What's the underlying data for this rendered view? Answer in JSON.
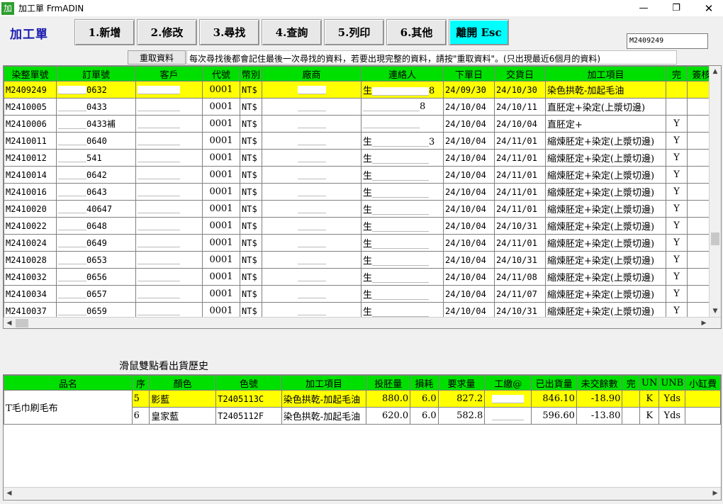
{
  "window": {
    "icon_text": "加",
    "title": "加工單 FrmADIN",
    "min": "—",
    "max": "❐",
    "close": "✕"
  },
  "form_title": "加工單",
  "toolbar": [
    {
      "label": "1.新增"
    },
    {
      "label": "2.修改"
    },
    {
      "label": "3.尋找"
    },
    {
      "label": "4.查詢"
    },
    {
      "label": "5.列印"
    },
    {
      "label": "6.其他"
    },
    {
      "label": "離開 Esc"
    }
  ],
  "current_code": "M2409249",
  "reload_label": "重取資料",
  "hint_text": "每次尋找後都會記住最後一次尋找的資料，若要出現完整的資料，請按\"重取資料\"。(只出現最近6個月的資料)",
  "orders": {
    "columns": [
      "染整單號",
      "訂單號",
      "客戶",
      "代號",
      "幣別",
      "廠商",
      "連絡人",
      "下單日",
      "交貨日",
      "加工項目",
      "完",
      "簽核"
    ],
    "rows": [
      {
        "no": "M2409249",
        "order": "0632",
        "code": "0001",
        "cur": "NT$",
        "contact_prefix": "生",
        "contact_suffix": "8",
        "order_date": "24/09/30",
        "due": "24/10/30",
        "item": "染色拱乾-加起毛油",
        "done": ""
      },
      {
        "no": "M2410005",
        "order": "0433",
        "code": "0001",
        "cur": "NT$",
        "contact_prefix": "",
        "contact_suffix": "8",
        "order_date": "24/10/04",
        "due": "24/10/11",
        "item": "直胚定+染定(上漿切邊)",
        "done": ""
      },
      {
        "no": "M2410006",
        "order": "0433補",
        "code": "0001",
        "cur": "NT$",
        "contact_prefix": "",
        "contact_suffix": "",
        "order_date": "24/10/04",
        "due": "24/10/04",
        "item": "直胚定+",
        "done": "Y"
      },
      {
        "no": "M2410011",
        "order": "0640",
        "code": "0001",
        "cur": "NT$",
        "contact_prefix": "生",
        "contact_suffix": "3",
        "order_date": "24/10/04",
        "due": "24/11/01",
        "item": "縮煉胚定+染定(上漿切邊)",
        "done": "Y"
      },
      {
        "no": "M2410012",
        "order": "541",
        "code": "0001",
        "cur": "NT$",
        "contact_prefix": "生",
        "contact_suffix": "",
        "order_date": "24/10/04",
        "due": "24/11/01",
        "item": "縮煉胚定+染定(上漿切邊)",
        "done": "Y"
      },
      {
        "no": "M2410014",
        "order": "0642",
        "code": "0001",
        "cur": "NT$",
        "contact_prefix": "生",
        "contact_suffix": "",
        "order_date": "24/10/04",
        "due": "24/11/01",
        "item": "縮煉胚定+染定(上漿切邊)",
        "done": "Y"
      },
      {
        "no": "M2410016",
        "order": "0643",
        "code": "0001",
        "cur": "NT$",
        "contact_prefix": "生",
        "contact_suffix": "",
        "order_date": "24/10/04",
        "due": "24/11/01",
        "item": "縮煉胚定+染定(上漿切邊)",
        "done": "Y"
      },
      {
        "no": "M2410020",
        "order": "40647",
        "code": "0001",
        "cur": "NT$",
        "contact_prefix": "生",
        "contact_suffix": "",
        "order_date": "24/10/04",
        "due": "24/11/01",
        "item": "縮煉胚定+染定(上漿切邊)",
        "done": "Y"
      },
      {
        "no": "M2410022",
        "order": "0648",
        "code": "0001",
        "cur": "NT$",
        "contact_prefix": "生",
        "contact_suffix": "",
        "order_date": "24/10/04",
        "due": "24/10/31",
        "item": "縮煉胚定+染定(上漿切邊)",
        "done": "Y"
      },
      {
        "no": "M2410024",
        "order": "0649",
        "code": "0001",
        "cur": "NT$",
        "contact_prefix": "生",
        "contact_suffix": "",
        "order_date": "24/10/04",
        "due": "24/11/01",
        "item": "縮煉胚定+染定(上漿切邊)",
        "done": "Y"
      },
      {
        "no": "M2410028",
        "order": "0653",
        "code": "0001",
        "cur": "NT$",
        "contact_prefix": "生",
        "contact_suffix": "",
        "order_date": "24/10/04",
        "due": "24/10/31",
        "item": "縮煉胚定+染定(上漿切邊)",
        "done": "Y"
      },
      {
        "no": "M2410032",
        "order": "0656",
        "code": "0001",
        "cur": "NT$",
        "contact_prefix": "生",
        "contact_suffix": "",
        "order_date": "24/10/04",
        "due": "24/11/08",
        "item": "縮煉胚定+染定(上漿切邊)",
        "done": "Y"
      },
      {
        "no": "M2410034",
        "order": "0657",
        "code": "0001",
        "cur": "NT$",
        "contact_prefix": "生",
        "contact_suffix": "",
        "order_date": "24/10/04",
        "due": "24/11/07",
        "item": "縮煉胚定+染定(上漿切邊)",
        "done": "Y"
      },
      {
        "no": "M2410037",
        "order": "0659",
        "code": "0001",
        "cur": "NT$",
        "contact_prefix": "生",
        "contact_suffix": "",
        "order_date": "24/10/04",
        "due": "24/10/31",
        "item": "縮煉胚定+染定(上漿切邊)",
        "done": "Y"
      }
    ]
  },
  "detail_label": "滑鼠雙點看出貨歷史",
  "details": {
    "columns": [
      "品名",
      "序",
      "顏色",
      "色號",
      "加工項目",
      "投胚量",
      "損耗",
      "要求量",
      "工繳@",
      "已出貨量",
      "未交餘數",
      "完",
      "UN",
      "UNB",
      "小缸費"
    ],
    "product_name": "T毛巾刷毛布",
    "rows": [
      {
        "seq": "5",
        "color": "影藍",
        "color_no": "T2405113C",
        "item": "染色拱乾-加起毛油",
        "input": "880.0",
        "loss": "6.0",
        "req": "827.2",
        "shipped": "846.10",
        "remain": "-18.90",
        "done": "",
        "un": "K",
        "unb": "Yds"
      },
      {
        "seq": "6",
        "color": "皇家藍",
        "color_no": "T2405112F",
        "item": "染色拱乾-加起毛油",
        "input": "620.0",
        "loss": "6.0",
        "req": "582.8",
        "shipped": "596.60",
        "remain": "-13.80",
        "done": "",
        "un": "K",
        "unb": "Yds"
      }
    ]
  },
  "colors": {
    "header": "#00e000",
    "selected": "#ffff00",
    "exit_button": "#00ffff",
    "title": "#1a1ab0"
  }
}
